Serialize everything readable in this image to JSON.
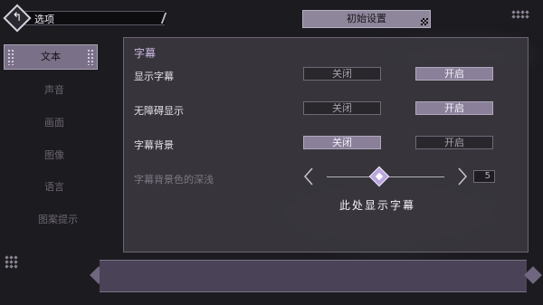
{
  "header": {
    "back_title": "选项",
    "init_button": "初始设置"
  },
  "sidebar": {
    "items": [
      {
        "label": "文本",
        "active": true
      },
      {
        "label": "声音",
        "active": false
      },
      {
        "label": "画面",
        "active": false
      },
      {
        "label": "图像",
        "active": false
      },
      {
        "label": "语言",
        "active": false
      },
      {
        "label": "图案提示",
        "active": false
      }
    ]
  },
  "panel": {
    "section_title": "字幕",
    "rows": [
      {
        "label": "显示字幕",
        "off_label": "关闭",
        "on_label": "开启",
        "selected": "on"
      },
      {
        "label": "无障碍显示",
        "off_label": "关闭",
        "on_label": "开启",
        "selected": "on"
      },
      {
        "label": "字幕背景",
        "off_label": "关闭",
        "on_label": "开启",
        "selected": "off"
      }
    ],
    "slider": {
      "label": "字幕背景色的深浅",
      "value": "5",
      "level_fraction": 0.45
    },
    "preview_text": "此处显示字幕"
  },
  "icons": {
    "back": "back-arrow-icon",
    "slider_left": "chevron-left-icon",
    "slider_right": "chevron-right-icon"
  },
  "colors": {
    "accent": "#8a809a",
    "section_title": "#cbb9e6"
  }
}
